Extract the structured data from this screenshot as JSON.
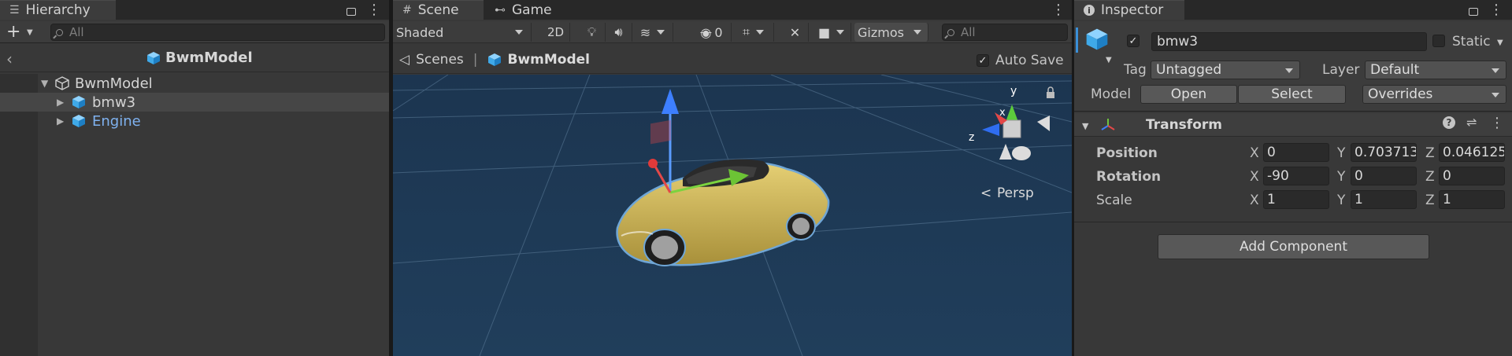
{
  "hierarchy": {
    "tab_label": "Hierarchy",
    "search_placeholder": "All",
    "prefab_title": "BwmModel",
    "items": [
      {
        "label": "BwmModel",
        "color": "#d4d4d4"
      },
      {
        "label": "bmw3",
        "color": "#d4d4d4"
      },
      {
        "label": "Engine",
        "color": "#7fb2f0"
      }
    ]
  },
  "scene": {
    "tabs": [
      {
        "label": "Scene",
        "icon": "grid-icon"
      },
      {
        "label": "Game",
        "icon": "gamepad-icon"
      }
    ],
    "shading_mode": "Shaded",
    "mode_2d": "2D",
    "hidden_count": "0",
    "gizmos_label": "Gizmos",
    "search_placeholder": "All",
    "breadcrumb": [
      "Scenes",
      "BwmModel"
    ],
    "auto_save_label": "Auto Save",
    "auto_save_checked": true,
    "gizmo_axes": {
      "y": "y",
      "x": "x",
      "z": "z"
    },
    "projection_label": "Persp",
    "viewport_color": "#1d3750"
  },
  "inspector": {
    "tab_label": "Inspector",
    "object_name": "bmw3",
    "active_checked": true,
    "static_label": "Static",
    "tag_label": "Tag",
    "tag_value": "Untagged",
    "layer_label": "Layer",
    "layer_value": "Default",
    "model_label": "Model",
    "open_label": "Open",
    "select_label": "Select",
    "overrides_label": "Overrides",
    "transform": {
      "title": "Transform",
      "rows": [
        {
          "label": "Position",
          "x": "0",
          "y": "0.703713",
          "z": "0.046125"
        },
        {
          "label": "Rotation",
          "x": "-90",
          "y": "0",
          "z": "0"
        },
        {
          "label": "Scale",
          "x": "1",
          "y": "1",
          "z": "1"
        }
      ],
      "axis_labels": [
        "X",
        "Y",
        "Z"
      ]
    },
    "add_component_label": "Add Component"
  }
}
